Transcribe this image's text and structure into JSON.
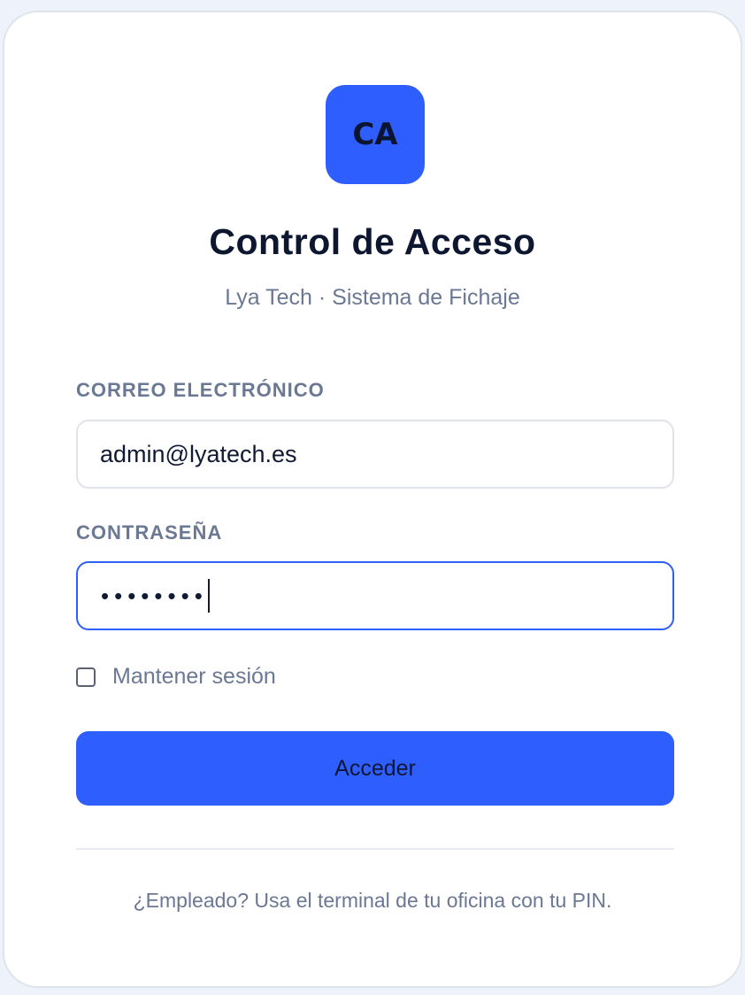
{
  "logo": {
    "initials": "CA"
  },
  "header": {
    "title": "Control de Acceso",
    "subtitle": "Lya Tech · Sistema de Fichaje"
  },
  "form": {
    "email_label": "CORREO ELECTRÓNICO",
    "email_value": "admin@lyatech.es",
    "password_label": "CONTRASEÑA",
    "password_mask": "••••••••",
    "remember_label": "Mantener sesión",
    "remember_checked": false,
    "submit_label": "Acceder"
  },
  "footer": {
    "note": "¿Empleado? Usa el terminal de tu oficina con tu PIN."
  },
  "colors": {
    "accent": "#2f5eff",
    "background": "#eef2fb",
    "muted_text": "#6b7894",
    "heading_text": "#0e1730"
  }
}
